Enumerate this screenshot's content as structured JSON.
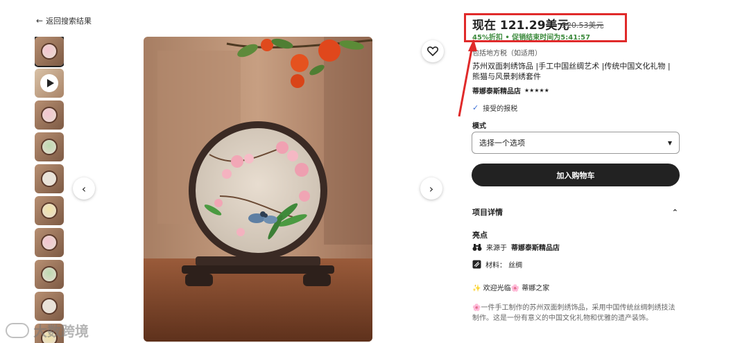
{
  "nav": {
    "back_label": "返回搜索结果"
  },
  "gallery": {
    "thumbnails": [
      {
        "name": "thumb-1",
        "kind": "image",
        "active": true
      },
      {
        "name": "thumb-2",
        "kind": "video"
      },
      {
        "name": "thumb-3",
        "kind": "image"
      },
      {
        "name": "thumb-4",
        "kind": "image"
      },
      {
        "name": "thumb-5",
        "kind": "image"
      },
      {
        "name": "thumb-6",
        "kind": "image"
      },
      {
        "name": "thumb-7",
        "kind": "image"
      },
      {
        "name": "thumb-8",
        "kind": "image"
      },
      {
        "name": "thumb-9",
        "kind": "image"
      },
      {
        "name": "thumb-10",
        "kind": "image"
      }
    ],
    "prev_icon": "chevron-left-icon",
    "next_icon": "chevron-right-icon",
    "favorite_icon": "heart-icon"
  },
  "product": {
    "price_now": "现在 121.29美元",
    "price_old": "220.53美元",
    "discount_promo": "45%折扣 • 促销结束时间为5:41:57",
    "tax_note": "包括地方税（如适用）",
    "title": "苏州双面刺绣饰品 |手工中国丝绸艺术 |传统中国文化礼物 |熊猫与风景刺绣套件",
    "shop_name": "蒂娜泰斯精品店",
    "rating_stars": "★★★★★",
    "returns_label": "接受的报税"
  },
  "options": {
    "style_label": "模式",
    "style_select_value": "选择一个选项"
  },
  "actions": {
    "add_to_cart_label": "加入购物车"
  },
  "details": {
    "header": "项目详情",
    "highlights_label": "亮点",
    "origin_prefix": "来源于",
    "origin_shop": "蒂娜泰斯精品店",
    "material": "材料：  丝绸",
    "welcome": "✨ 欢迎光临🌸 蒂娜之家",
    "description": "🌸一件手工制作的苏州双面刺绣饰品，采用中国传统丝绸刺绣技法制作。这是一份有意义的中国文化礼物和优雅的遗产装饰。"
  },
  "watermark": {
    "text": "大数跨境"
  },
  "colors": {
    "annotation": "#e02a2a",
    "promo_green": "#3c8a3c",
    "button_dark": "#222222"
  }
}
